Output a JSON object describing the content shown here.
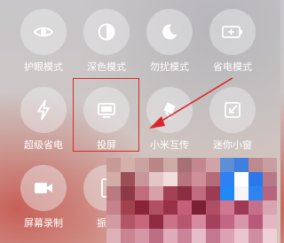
{
  "tiles": [
    {
      "label": "护眼模式",
      "icon": "eye-icon"
    },
    {
      "label": "深色模式",
      "icon": "dark-mode-icon"
    },
    {
      "label": "勿扰模式",
      "icon": "moon-icon"
    },
    {
      "label": "省电模式",
      "icon": "battery-icon"
    },
    {
      "label": "超级省电",
      "icon": "lightning-icon"
    },
    {
      "label": "投屏",
      "icon": "cast-screen-icon"
    },
    {
      "label": "小米互传",
      "icon": "mi-share-icon"
    },
    {
      "label": "迷你小窗",
      "icon": "mini-window-icon"
    },
    {
      "label": "屏幕录制",
      "icon": "screen-record-icon"
    },
    {
      "label": "振动",
      "icon": "vibrate-icon"
    }
  ],
  "annotation": {
    "highlight_color": "#d9282d",
    "arrow_color": "#d9282d",
    "highlighted_tile": "投屏"
  },
  "colors": {
    "label": "#ffffff",
    "tile_bg": "rgba(240,240,242,0.45)"
  }
}
